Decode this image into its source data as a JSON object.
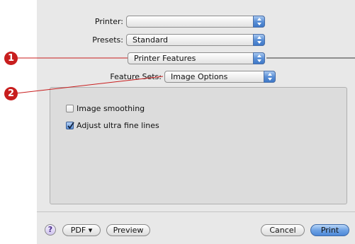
{
  "printer": {
    "label": "Printer:",
    "value": ""
  },
  "presets": {
    "label": "Presets:",
    "value": "Standard"
  },
  "pane_menu": {
    "value": "Printer Features"
  },
  "feature_sets": {
    "label": "Feature Sets:",
    "value": "Image Options"
  },
  "options": [
    {
      "label": "Image smoothing",
      "checked": false
    },
    {
      "label": "Adjust ultra fine lines",
      "checked": true
    }
  ],
  "footer": {
    "help_label": "?",
    "pdf_label": "PDF ▾",
    "preview_label": "Preview",
    "cancel_label": "Cancel",
    "print_label": "Print"
  },
  "callouts": [
    "1",
    "2"
  ],
  "colors": {
    "callout": "#c81e1e",
    "accent": "#5a8fd6"
  }
}
